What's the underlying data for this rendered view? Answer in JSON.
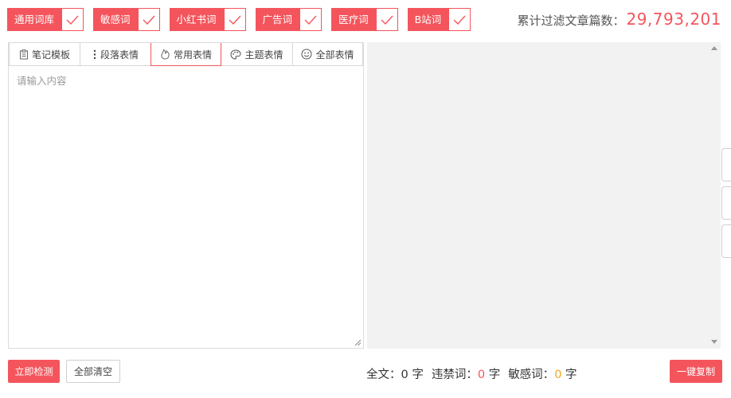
{
  "filters": [
    {
      "label": "通用词库",
      "checked": true
    },
    {
      "label": "敏感词",
      "checked": true
    },
    {
      "label": "小红书词",
      "checked": true
    },
    {
      "label": "广告词",
      "checked": true
    },
    {
      "label": "医疗词",
      "checked": true
    },
    {
      "label": "B站词",
      "checked": true
    }
  ],
  "counter": {
    "label": "累计过滤文章篇数：",
    "value": "29,793,201"
  },
  "toolbar": {
    "notes_template": "笔记模板",
    "paragraph_emoji": "段落表情",
    "common_emoji": "常用表情",
    "theme_emoji": "主题表情",
    "all_emoji": "全部表情"
  },
  "editor": {
    "placeholder": "请输入内容"
  },
  "actions": {
    "detect": "立即检测",
    "clear": "全部清空",
    "copy": "一键复制"
  },
  "stats": {
    "total_label": "全文：",
    "total_value": "0",
    "total_unit": "字",
    "banned_label": "违禁词：",
    "banned_value": "0",
    "banned_unit": "字",
    "sensitive_label": "敏感词：",
    "sensitive_value": "0",
    "sensitive_unit": "字"
  },
  "colors": {
    "accent": "#f4555c",
    "sensitive": "#f5a623",
    "preview_bg": "#f2f2f2"
  }
}
